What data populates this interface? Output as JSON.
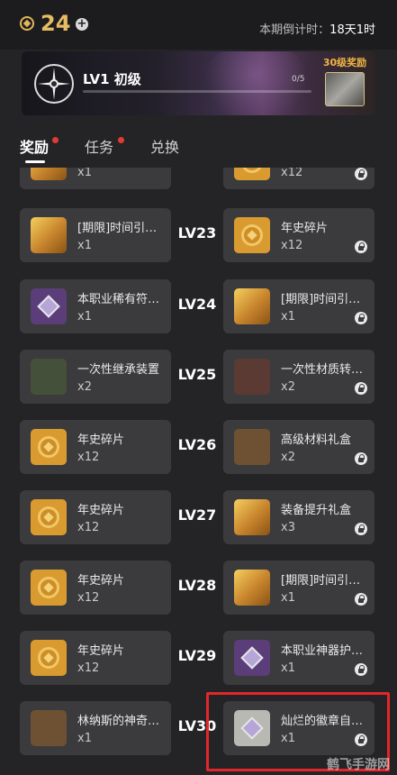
{
  "header": {
    "points": "24",
    "countdown_label": "本期倒计时：",
    "countdown_value": "18天1时"
  },
  "banner": {
    "level": "LV1 初级",
    "progress_text": "0/5",
    "progress": 0.0,
    "reward_label": "30级奖励"
  },
  "tabs": [
    {
      "label": "奖励",
      "active": true,
      "dot": true
    },
    {
      "label": "任务",
      "active": false,
      "dot": true
    },
    {
      "label": "兑换",
      "active": false,
      "dot": false
    }
  ],
  "rows": [
    {
      "lv": "",
      "left": {
        "name": "",
        "qty": "x1",
        "icon": "chest-icon"
      },
      "right": {
        "name": "",
        "qty": "x12",
        "icon": "medal-icon",
        "locked": true
      }
    },
    {
      "lv": "LV23",
      "left": {
        "name": "[期限]时间引导者的宝箱",
        "qty": "x1",
        "icon": "chest-icon"
      },
      "right": {
        "name": "年史碎片",
        "qty": "x12",
        "icon": "medal-icon",
        "locked": true
      }
    },
    {
      "lv": "LV24",
      "left": {
        "name": "本职业稀有符文箱",
        "qty": "x1",
        "icon": "rune-icon"
      },
      "right": {
        "name": "[期限]时间引导者的宝箱",
        "qty": "x1",
        "icon": "chest-icon",
        "locked": true
      }
    },
    {
      "lv": "LV25",
      "left": {
        "name": "一次性继承装置",
        "qty": "x2",
        "icon": "inherit-icon"
      },
      "right": {
        "name": "一次性材质转换器",
        "qty": "x2",
        "icon": "convert-icon",
        "locked": true
      }
    },
    {
      "lv": "LV26",
      "left": {
        "name": "年史碎片",
        "qty": "x12",
        "icon": "medal-icon"
      },
      "right": {
        "name": "高级材料礼盒",
        "qty": "x2",
        "icon": "giftbox-icon",
        "locked": true
      }
    },
    {
      "lv": "LV27",
      "left": {
        "name": "年史碎片",
        "qty": "x12",
        "icon": "medal-icon"
      },
      "right": {
        "name": "装备提升礼盒",
        "qty": "x3",
        "icon": "chest-icon",
        "locked": true
      }
    },
    {
      "lv": "LV28",
      "left": {
        "name": "年史碎片",
        "qty": "x12",
        "icon": "medal-icon"
      },
      "right": {
        "name": "[期限]时间引导者的宝箱",
        "qty": "x1",
        "icon": "chest-icon",
        "locked": true
      }
    },
    {
      "lv": "LV29",
      "left": {
        "name": "年史碎片",
        "qty": "x12",
        "icon": "medal-icon"
      },
      "right": {
        "name": "本职业神器护石箱",
        "qty": "x1",
        "icon": "rune-icon",
        "locked": true
      }
    },
    {
      "lv": "LV30",
      "left": {
        "name": "林纳斯的神奇卷轴",
        "qty": "x1",
        "icon": "scroll-icon"
      },
      "right": {
        "name": "灿烂的徽章自选箱",
        "qty": "x1",
        "icon": "badge-icon",
        "locked": true
      }
    }
  ],
  "watermark": "鹤飞手游网",
  "colors": {
    "accent": "#e6bc62",
    "highlight": "#e3262b",
    "card": "#3b3b3d"
  }
}
